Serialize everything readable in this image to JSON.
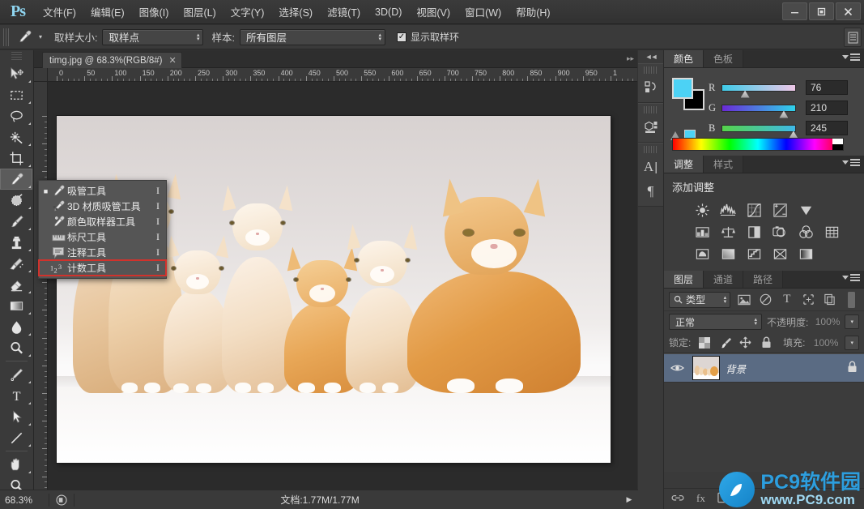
{
  "app": {
    "logo": "Ps",
    "menus": [
      {
        "label": "文件(F)"
      },
      {
        "label": "编辑(E)"
      },
      {
        "label": "图像(I)"
      },
      {
        "label": "图层(L)"
      },
      {
        "label": "文字(Y)"
      },
      {
        "label": "选择(S)"
      },
      {
        "label": "滤镜(T)"
      },
      {
        "label": "3D(D)"
      },
      {
        "label": "视图(V)"
      },
      {
        "label": "窗口(W)"
      },
      {
        "label": "帮助(H)"
      }
    ],
    "window_controls": {
      "minimize": "—",
      "maximize": "▫",
      "close": "✕"
    }
  },
  "options_bar": {
    "tool_icon": "eyedropper-icon",
    "sample_size_label": "取样大小:",
    "sample_size_value": "取样点",
    "sample_label": "样本:",
    "sample_value": "所有图层",
    "show_ring_label": "显示取样环",
    "show_ring_checked": true,
    "check_glyph": "✓"
  },
  "toolbar": {
    "tools": [
      {
        "name": "move-tool",
        "selected": false
      },
      {
        "name": "rectangular-marquee-tool",
        "selected": false
      },
      {
        "name": "lasso-tool",
        "selected": false
      },
      {
        "name": "magic-wand-tool",
        "selected": false
      },
      {
        "name": "crop-tool",
        "selected": false
      },
      {
        "name": "eyedropper-tool",
        "selected": true
      },
      {
        "name": "healing-brush-tool",
        "selected": false
      },
      {
        "name": "brush-tool",
        "selected": false
      },
      {
        "name": "clone-stamp-tool",
        "selected": false
      },
      {
        "name": "history-brush-tool",
        "selected": false
      },
      {
        "name": "eraser-tool",
        "selected": false
      },
      {
        "name": "gradient-tool",
        "selected": false
      },
      {
        "name": "blur-tool",
        "selected": false
      },
      {
        "name": "dodge-tool",
        "selected": false
      },
      {
        "name": "pen-tool",
        "selected": false
      },
      {
        "name": "type-tool",
        "selected": false
      },
      {
        "name": "path-selection-tool",
        "selected": false
      },
      {
        "name": "line-shape-tool",
        "selected": false
      },
      {
        "name": "hand-tool",
        "selected": false
      },
      {
        "name": "zoom-tool",
        "selected": false
      }
    ]
  },
  "flyout_menu": {
    "items": [
      {
        "icon": "eyedropper-icon",
        "label": "吸管工具",
        "shortcut": "I",
        "current": true,
        "highlighted": false
      },
      {
        "icon": "3d-material-eyedropper-icon",
        "label": "3D 材质吸管工具",
        "shortcut": "I",
        "current": false,
        "highlighted": false
      },
      {
        "icon": "color-sampler-icon",
        "label": "颜色取样器工具",
        "shortcut": "I",
        "current": false,
        "highlighted": false
      },
      {
        "icon": "ruler-icon",
        "label": "标尺工具",
        "shortcut": "I",
        "current": false,
        "highlighted": false
      },
      {
        "icon": "note-icon",
        "label": "注释工具",
        "shortcut": "I",
        "current": false,
        "highlighted": false
      },
      {
        "icon": "count-icon",
        "label": "计数工具",
        "shortcut": "I",
        "current": false,
        "highlighted": true
      }
    ]
  },
  "document": {
    "tab_title": "timg.jpg @ 68.3%(RGB/8#)",
    "close_glyph": "✕",
    "ruler_h_labels": [
      "0",
      "50",
      "100",
      "150",
      "200",
      "250",
      "300",
      "350",
      "400",
      "450",
      "500",
      "550",
      "600",
      "650",
      "700",
      "750",
      "800",
      "850",
      "900",
      "950",
      "1"
    ],
    "ruler_v_labels": [
      "0",
      "5",
      "0",
      "1",
      "0",
      "0",
      "1",
      "5",
      "0",
      "2",
      "0",
      "0",
      "2",
      "5",
      "0",
      "3",
      "0",
      "0",
      "3",
      "5",
      "0",
      "4",
      "0",
      "0"
    ]
  },
  "dock_mini": {
    "collapse_glyph": "◄◄",
    "buttons": [
      {
        "name": "history-panel-icon"
      },
      {
        "name": "properties-panel-icon"
      },
      {
        "name": "character-panel-icon",
        "glyph": "A"
      },
      {
        "name": "paragraph-panel-icon",
        "glyph": "¶"
      }
    ]
  },
  "color_panel": {
    "tabs": [
      {
        "label": "颜色",
        "active": true
      },
      {
        "label": "色板",
        "active": false
      }
    ],
    "foreground_hex": "#4cd2f5",
    "background_hex": "#000000",
    "channels": [
      {
        "label": "R",
        "value": "76",
        "pos": 0.3
      },
      {
        "label": "G",
        "value": "210",
        "pos": 0.82
      },
      {
        "label": "B",
        "value": "245",
        "pos": 0.95
      }
    ]
  },
  "adjustments_panel": {
    "tabs": [
      {
        "label": "调整",
        "active": true
      },
      {
        "label": "样式",
        "active": false
      }
    ],
    "title": "添加调整",
    "rows": [
      [
        {
          "name": "brightness-contrast-icon"
        },
        {
          "name": "levels-icon"
        },
        {
          "name": "curves-icon"
        },
        {
          "name": "exposure-icon"
        },
        {
          "name": "vibrance-icon"
        }
      ],
      [
        {
          "name": "hue-saturation-icon"
        },
        {
          "name": "color-balance-icon"
        },
        {
          "name": "black-white-icon"
        },
        {
          "name": "photo-filter-icon"
        },
        {
          "name": "channel-mixer-icon"
        },
        {
          "name": "color-lookup-icon"
        }
      ],
      [
        {
          "name": "invert-icon"
        },
        {
          "name": "posterize-icon"
        },
        {
          "name": "threshold-icon"
        },
        {
          "name": "selective-color-icon"
        },
        {
          "name": "gradient-map-icon"
        }
      ]
    ]
  },
  "layers_panel": {
    "tabs": [
      {
        "label": "图层",
        "active": true
      },
      {
        "label": "通道",
        "active": false
      },
      {
        "label": "路径",
        "active": false
      }
    ],
    "filter_label": "类型",
    "filter_icons": [
      {
        "name": "filter-pixel-icon"
      },
      {
        "name": "filter-adjustment-icon"
      },
      {
        "name": "filter-type-icon",
        "glyph": "T"
      },
      {
        "name": "filter-shape-icon"
      },
      {
        "name": "filter-smartobject-icon"
      }
    ],
    "blend_mode": "正常",
    "opacity_label": "不透明度:",
    "opacity_value": "100%",
    "lock_label": "锁定:",
    "lock_icons": [
      {
        "name": "lock-transparency-icon"
      },
      {
        "name": "lock-image-icon"
      },
      {
        "name": "lock-position-icon"
      },
      {
        "name": "lock-all-icon"
      }
    ],
    "fill_label": "填充:",
    "fill_value": "100%",
    "layers": [
      {
        "name": "背景",
        "visible": true,
        "locked": true,
        "selected": true
      }
    ],
    "bottom_icons": [
      {
        "name": "link-layers-icon"
      },
      {
        "name": "layer-style-icon"
      },
      {
        "name": "layer-mask-icon"
      }
    ]
  },
  "status_bar": {
    "zoom": "68.3%",
    "doc_info": "文档:1.77M/1.77M",
    "arrow_glyph": "▶"
  },
  "watermark": {
    "main": "PC9软件园",
    "sub": "www.PC9.com",
    "color": "#2d9ede"
  },
  "colors": {
    "chrome": "#3a3a3a",
    "panel": "#444444",
    "canvas_bg": "#2b2b2b",
    "selection_blue": "#5a6b83",
    "highlight_red": "#d1322c"
  }
}
